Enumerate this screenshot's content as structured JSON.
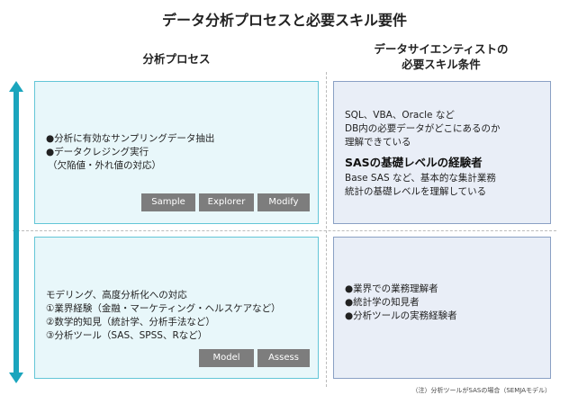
{
  "title": "データ分析プロセスと必要スキル要件",
  "left_header": "分析プロセス",
  "right_header_lines": [
    "データサイエンティストの",
    "必要スキル条件"
  ],
  "top_left": {
    "lines": [
      "●分析に有効なサンプリングデータ抽出",
      "●データクレジング実行",
      "（欠陥値・外れ値の対応）"
    ],
    "buttons": [
      "Sample",
      "Explorer",
      "Modify"
    ]
  },
  "top_right": {
    "lines_before": [
      "SQL、VBA、Oracle など",
      "DB内の必要データがどこにあるのか",
      "理解できている"
    ],
    "heading": "SASの基礎レベルの経験者",
    "lines_after": [
      "Base SAS など、基本的な集計業務",
      "統計の基礎レベルを理解している"
    ]
  },
  "bottom_left": {
    "lines": [
      "モデリング、高度分析化への対応",
      "①業界経験（金融・マーケティング・ヘルスケアなど）",
      "②数学的知見（統計学、分析手法など）",
      "③分析ツール（SAS、SPSS、Rなど）"
    ],
    "buttons": [
      "Model",
      "Assess"
    ]
  },
  "bottom_right": {
    "lines": [
      "●業界での業務理解者",
      "●統計学の知見者",
      "●分析ツールの実務経験者"
    ]
  },
  "footnote": "（注）分析ツールがSASの場合（SEMJAモデル）",
  "colors": {
    "arrow": "#1aa5bd",
    "left_box_fill": "#e8f7fa",
    "left_box_border": "#63c6d7",
    "right_box_fill": "#e9eef7",
    "right_box_border": "#8aa0c4",
    "button_fill": "#7d7d7d"
  }
}
